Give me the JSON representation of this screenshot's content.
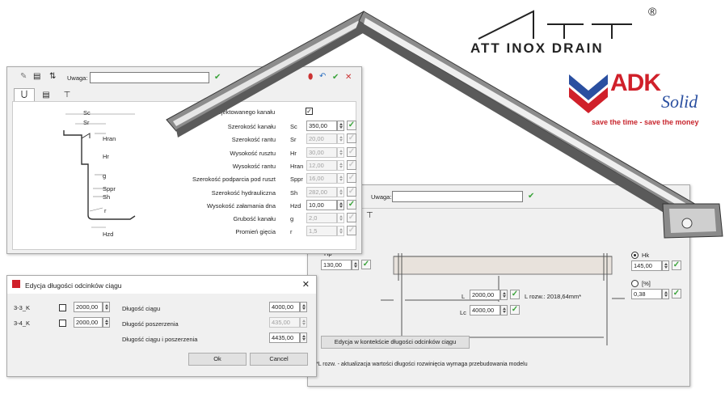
{
  "colors": {
    "accent_red": "#d0202a",
    "accent_blue": "#2a4fa0",
    "ok_green": "#3aa33a"
  },
  "brand": {
    "att_text": "ATT INOX DRAIN",
    "registered": "®",
    "adk_word": "ADK",
    "adk_solid": "Solid",
    "adk_slogan": "save the time - save the money"
  },
  "main_window": {
    "uwaga_label": "Uwaga:",
    "uwaga_value": "",
    "checkbox_label": "projektowanego kanału",
    "checkbox_mark": "✓",
    "diagram_labels": {
      "sc": "Sc",
      "sr": "Sr",
      "hran": "Hran",
      "hr": "Hr",
      "g": "g",
      "sppr": "Sppr",
      "sh": "Sh",
      "r": "r",
      "hzd": "Hzd"
    },
    "rows": [
      {
        "label": "Szerokość kanału",
        "code": "Sc",
        "value": "350,00",
        "enabled": true
      },
      {
        "label": "Szerokość rantu",
        "code": "Sr",
        "value": "20,00",
        "enabled": false
      },
      {
        "label": "Wysokość rusztu",
        "code": "Hr",
        "value": "30,00",
        "enabled": false
      },
      {
        "label": "Wysokość rantu",
        "code": "Hran",
        "value": "12,00",
        "enabled": false
      },
      {
        "label": "Szerokość podparcia pod ruszt",
        "code": "Sppr",
        "value": "16,00",
        "enabled": false
      },
      {
        "label": "Szerokość hydrauliczna",
        "code": "Sh",
        "value": "282,00",
        "enabled": false
      },
      {
        "label": "Wysokość załamania dna",
        "code": "Hzd",
        "value": "10,00",
        "enabled": true
      },
      {
        "label": "Grubość kanału",
        "code": "g",
        "value": "2,0",
        "enabled": false
      },
      {
        "label": "Promień gięcia",
        "code": "r",
        "value": "1,5",
        "enabled": false
      }
    ]
  },
  "dialog": {
    "title": "Edycja długości odcinków ciągu",
    "close": "✕",
    "row1": {
      "name": "3-3_K",
      "value": "2000,00"
    },
    "row2": {
      "name": "3-4_K",
      "value": "2000,00"
    },
    "dlugosc_ciagu_label": "Długość ciągu",
    "dlugosc_ciagu_value": "4000,00",
    "dlugosc_poszerzenia_label": "Długość poszerzenia",
    "dlugosc_poszerzenia_value": "435,00",
    "dlugosc_suma_label": "Długość ciągu i poszerzenia",
    "dlugosc_suma_value": "4435,00",
    "ok_label": "Ok",
    "cancel_label": "Cancel"
  },
  "right_window": {
    "uwaga_label": "Uwaga:",
    "uwaga_value": "",
    "hp_label": "Hp",
    "hp_value": "130,00",
    "hk_label": "Hk",
    "hk_value": "145,00",
    "pct_label": "[%]",
    "pct_value": "0,38",
    "l_label": "L",
    "l_value": "2000,00",
    "l_rozw": "L rozw.: 2018,64mm*",
    "lc_label": "Lc",
    "lc_value": "4000,00",
    "edit_button": "Edycja w kontekście długości odcinków ciągu",
    "footnote": "*L rozw. - aktualizacja wartości długości rozwinięcia wymaga przebudowania modelu"
  }
}
